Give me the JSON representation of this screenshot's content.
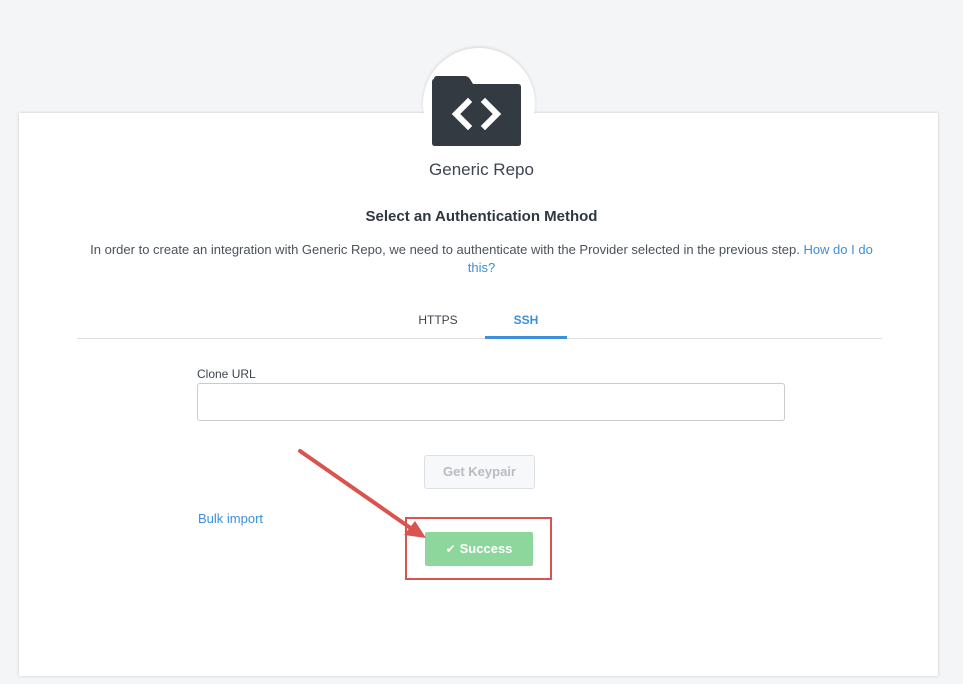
{
  "provider": {
    "name": "Generic Repo",
    "icon": "code-folder-icon"
  },
  "auth": {
    "title": "Select an Authentication Method",
    "description": "In order to create an integration with Generic Repo, we need to authenticate with the Provider selected in the previous step.",
    "help_link": "How do I do this?"
  },
  "tabs": [
    {
      "label": "HTTPS",
      "active": false
    },
    {
      "label": "SSH",
      "active": true
    }
  ],
  "form": {
    "clone_url_label": "Clone URL",
    "clone_url_value": "",
    "get_keypair_label": "Get Keypair",
    "bulk_import_label": "Bulk import",
    "success_label": "Success",
    "success_icon": "check-icon"
  },
  "colors": {
    "link": "#3d8fd8",
    "success": "#8dd69c",
    "annotation": "#d9534f",
    "icon": "#333a42"
  }
}
